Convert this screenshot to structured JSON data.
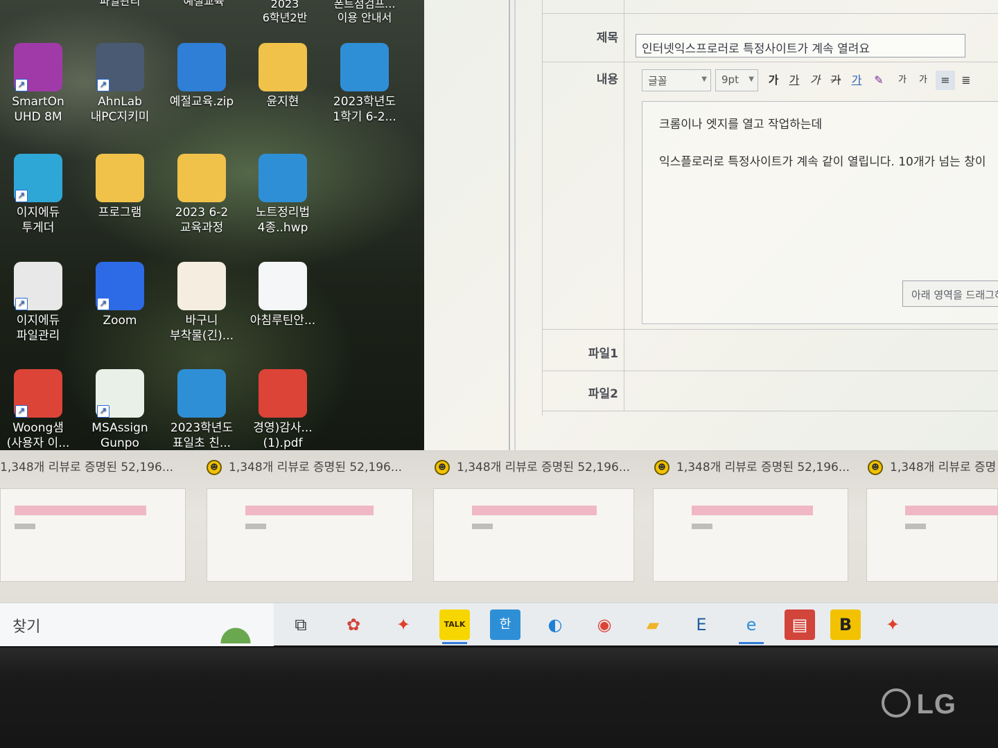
{
  "desktop": {
    "top_labels": [
      "파일관리",
      "예절교육",
      "2023\n6학년2반",
      "폰트점검프...\n이용 안내서"
    ],
    "icons": [
      {
        "label": "SmartOn\nUHD 8M",
        "icon": "smarton-icon",
        "color": "#a03aa8"
      },
      {
        "label": "AhnLab\n내PC지키미",
        "icon": "ahnlab-icon",
        "color": "#4a5a72"
      },
      {
        "label": "예절교육.zip",
        "icon": "zip-icon",
        "color": "#2f7fd6"
      },
      {
        "label": "윤지현",
        "icon": "folder-icon",
        "color": "#f0c24a"
      },
      {
        "label": "2023학년도\n1학기 6-2...",
        "icon": "hwp-icon",
        "color": "#2f8fd6"
      },
      {
        "label": "이지에듀\n투게더",
        "icon": "easyedu-icon",
        "color": "#2fa7d6"
      },
      {
        "label": "프로그램",
        "icon": "folder-icon",
        "color": "#f0c24a"
      },
      {
        "label": "2023 6-2\n교육과정",
        "icon": "folder-icon",
        "color": "#f0c24a"
      },
      {
        "label": "노트정리법\n4종..hwp",
        "icon": "hwp-icon",
        "color": "#2f8fd6"
      },
      {
        "label": "이지에듀\n파일관리",
        "icon": "file-icon",
        "color": "#e8e8e8"
      },
      {
        "label": "Zoom",
        "icon": "zoom-icon",
        "color": "#2d6ae6"
      },
      {
        "label": "바구니\n부착물(긴)...",
        "icon": "image-icon",
        "color": "#f4ede0"
      },
      {
        "label": "아침루틴안...",
        "icon": "image-icon",
        "color": "#f4f6f8"
      },
      {
        "label": "Woong샘\n(사용자 이...",
        "icon": "chrome-icon",
        "color": "#db4437"
      },
      {
        "label": "MSAssign\nGunpo",
        "icon": "msassign-icon",
        "color": "#e8f0e8"
      },
      {
        "label": "2023학년도\n표일초 친...",
        "icon": "hwp-icon",
        "color": "#2f8fd6"
      },
      {
        "label": "경영)감사...\n(1).pdf",
        "icon": "chrome-icon",
        "color": "#db4437"
      }
    ]
  },
  "form": {
    "subject_label": "제목",
    "subject_value": "인터넷익스프로러로 특정사이트가 계속 열려요",
    "content_label": "내용",
    "font_select": "글꼴",
    "size_select": "9pt",
    "toolbar_buttons": [
      "가",
      "가",
      "가",
      "가",
      "가",
      "가",
      "가",
      "가"
    ],
    "content_lines": [
      "크롬이나 엣지를 열고 작업하는데",
      "익스플로러로 특정사이트가 계속 같이 열립니다. 10개가 넘는 창이"
    ],
    "drag_button": "아래 영역을 드래그하",
    "file1_label": "파일1",
    "file2_label": "파일2"
  },
  "previews": {
    "title": "1,348개 리뷰로 증명된 52,196...",
    "title_short": "1,348개 리뷰로 증명",
    "count": 5
  },
  "taskbar": {
    "search_label": "찾기",
    "items": [
      {
        "icon": "task-view-icon",
        "glyph": "⧉",
        "color": "#333"
      },
      {
        "icon": "pinwheel-icon",
        "glyph": "✿",
        "color": "#d2453a"
      },
      {
        "icon": "msassign-icon",
        "glyph": "✦",
        "color": "#e0402a"
      },
      {
        "icon": "kakaotalk-icon",
        "glyph": "TALK",
        "color": "#3a2a00"
      },
      {
        "icon": "hancom-icon",
        "glyph": "한",
        "color": "#2f8fd6"
      },
      {
        "icon": "edge-icon",
        "glyph": "◐",
        "color": "#1f7fd6"
      },
      {
        "icon": "chrome-icon",
        "glyph": "◉",
        "color": "#db4437"
      },
      {
        "icon": "file-explorer-icon",
        "glyph": "▰",
        "color": "#f0b429"
      },
      {
        "icon": "ebs-icon",
        "glyph": "E",
        "color": "#1f5fa0"
      },
      {
        "icon": "internet-explorer-icon",
        "glyph": "e",
        "color": "#2f8fd6"
      },
      {
        "icon": "presentation-icon",
        "glyph": "▤",
        "color": "#d2453a"
      },
      {
        "icon": "b-app-icon",
        "glyph": "B",
        "color": "#222"
      },
      {
        "icon": "msassign-icon",
        "glyph": "✦",
        "color": "#e0402a"
      }
    ]
  },
  "monitor": {
    "brand": "LG"
  }
}
